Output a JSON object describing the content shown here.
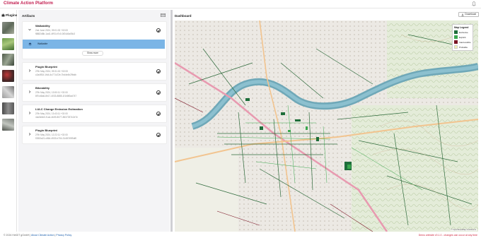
{
  "app": {
    "title": "Climate Action Platform"
  },
  "rail": {
    "label": "Plugins"
  },
  "artifacts": {
    "header": "Artifacts",
    "cards": [
      {
        "title": "Walkability",
        "date": "2nd June 2024, 09:01:32 +02:00",
        "id": "f8882d8b-1ad1-4f93-b7c0-0f24c5a05c3",
        "expanded": true
      },
      {
        "title": "Plugin Blueprint",
        "date": "27th May 2024, 09:31:15 +02:00",
        "id": "c2a4f51f-1fd4-4c77-b22e-7bd4e4b29bdb"
      },
      {
        "title": "Bikeability",
        "date": "27th May 2024, 13:50:11 +02:00",
        "id": "8f7cd6a6-8b17-4033-8885-1f1b8f0ad747"
      },
      {
        "title": "LULC Change Emission Estimation",
        "date": "27th May 2024, 13:43:11 +02:00",
        "id": "4dc5ebb0-f1a4-4b09-8077-8537257e2e7e"
      },
      {
        "title": "Plugin Blueprint",
        "date": "27th May 2024, 12:22:11 +02:00",
        "id": "f3353a21-c864-4533-b704-3148749f9df0"
      }
    ],
    "expanded_item": "Walkable",
    "show_more": "Show more"
  },
  "dashboard": {
    "title": "Dashboard",
    "download": "Download",
    "attribution": "© OpenStreetMap contributors",
    "legend": {
      "title": "Map Legend",
      "items": [
        {
          "label": "Exclusive",
          "color": "#1e6e3a"
        },
        {
          "label": "Explicit",
          "color": "#3aa84e"
        },
        {
          "label": "Inaccessible",
          "color": "#7a1424"
        },
        {
          "label": "Probable",
          "color": "#f3f0b0"
        }
      ]
    }
  },
  "footer": {
    "copyright": "© 2024 HeiGIT gGmbH",
    "about": "About Climate Action",
    "privacy": "Privacy Policy",
    "demo_notice": "Demo website v0.1.0 - changes can occur at any time"
  },
  "colors": {
    "brand": "#c0174a",
    "river": "#6fa8b8",
    "selected_row": "#7bb5e6"
  }
}
